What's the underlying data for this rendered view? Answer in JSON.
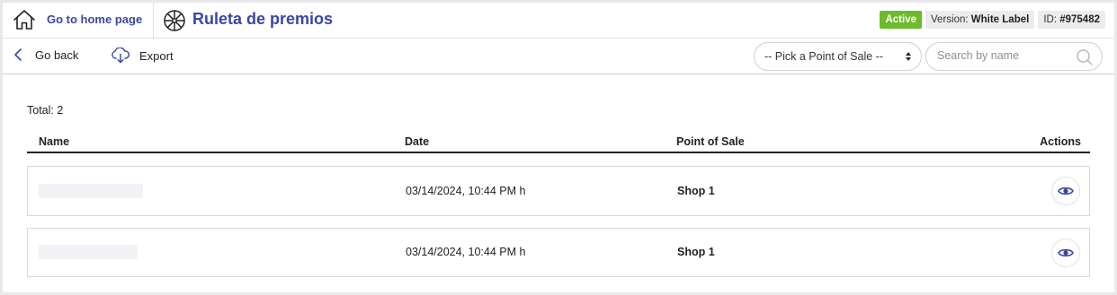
{
  "header": {
    "home_label": "Go to home page",
    "app_title": "Ruleta de premios",
    "status_badge": "Active",
    "version_prefix": "Version:",
    "version_value": "White Label",
    "id_prefix": "ID:",
    "id_value": "#975482",
    "icons": {
      "home": "home-icon",
      "app": "wheel-icon"
    }
  },
  "toolbar": {
    "back_label": "Go back",
    "export_label": "Export",
    "pos_select_value": "-- Pick a Point of Sale --",
    "search_placeholder": "Search by name",
    "icons": {
      "back": "chevron-left-icon",
      "export": "cloud-download-icon",
      "search": "search-icon"
    }
  },
  "table": {
    "total_label": "Total: 2",
    "columns": {
      "name": "Name",
      "date": "Date",
      "pos": "Point of Sale",
      "actions": "Actions"
    },
    "rows": [
      {
        "name": "",
        "date": "03/14/2024, 10:44 PM h",
        "pos": "Shop 1",
        "action_icon": "eye-icon"
      },
      {
        "name": "",
        "date": "03/14/2024, 10:44 PM h",
        "pos": "Shop 1",
        "action_icon": "eye-icon"
      }
    ]
  },
  "colors": {
    "accent": "#3a46a4",
    "active_badge": "#6dbb2c",
    "badge_grey": "#ececee"
  }
}
